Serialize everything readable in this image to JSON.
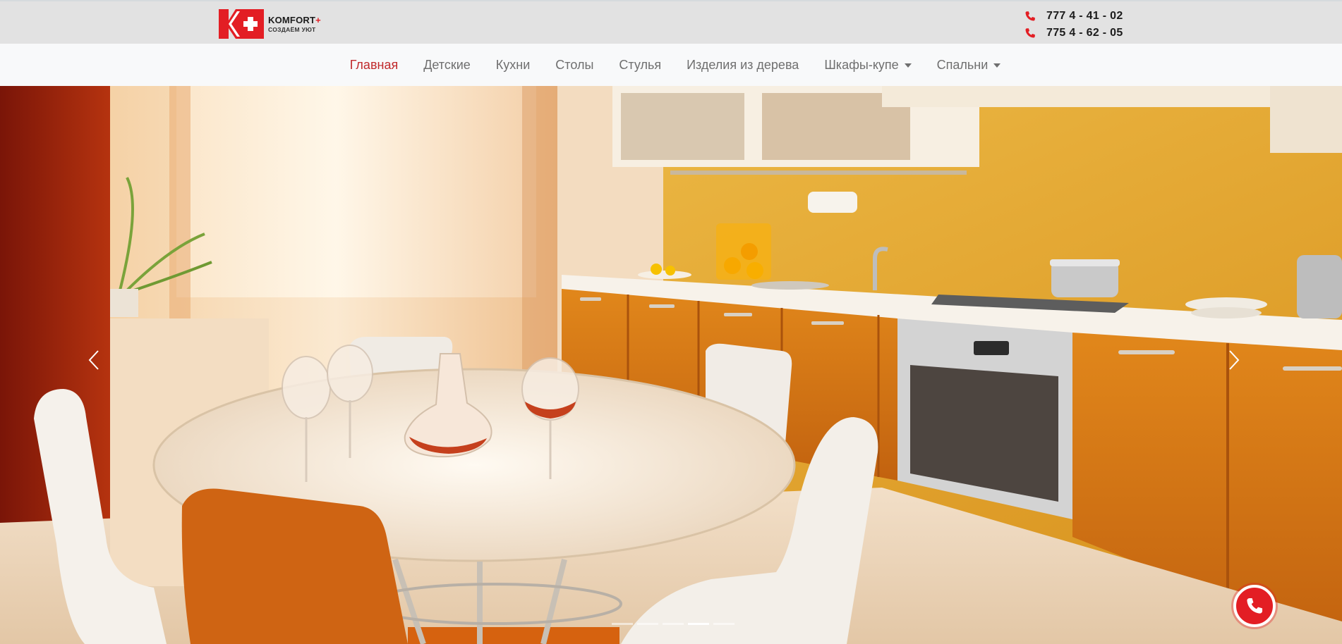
{
  "brand": {
    "name": "KOMFORT",
    "plus": "+",
    "slogan": "СОЗДАЁМ УЮТ",
    "red": "#e31e24"
  },
  "phones": [
    {
      "number": "777 4 - 41 - 02",
      "icon": "phone-icon"
    },
    {
      "number": "775 4 - 62 - 05",
      "icon": "phone-icon"
    }
  ],
  "nav": {
    "items": [
      {
        "label": "Главная",
        "active": true
      },
      {
        "label": "Детские"
      },
      {
        "label": "Кухни"
      },
      {
        "label": "Столы"
      },
      {
        "label": "Стулья"
      },
      {
        "label": "Изделия из дерева"
      },
      {
        "label": "Шкафы-купе",
        "dropdown": true
      },
      {
        "label": "Спальни",
        "dropdown": true
      }
    ],
    "active_color": "#c0292b"
  },
  "slider": {
    "indicators": 5,
    "active_index": 3,
    "prev_icon": "chevron-left-icon",
    "next_icon": "chevron-right-icon"
  },
  "call_button": {
    "icon": "phone-icon"
  }
}
